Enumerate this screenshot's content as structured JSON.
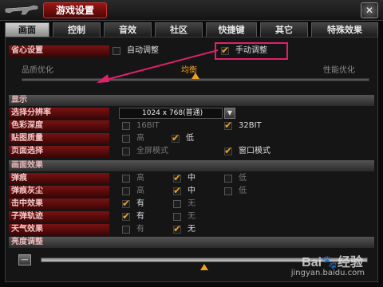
{
  "window": {
    "title": "游戏设置",
    "close_label": "✕"
  },
  "tabs": [
    "画面",
    "控制",
    "音效",
    "社区",
    "快捷键",
    "其它",
    "特殊效果"
  ],
  "quality": {
    "label": "省心设置",
    "auto_label": "自动调整",
    "manual_label": "手动调整",
    "auto_checked": false,
    "manual_checked": true,
    "left_label": "品质优化",
    "mid_label": "均衡",
    "right_label": "性能优化",
    "slider_value": 0.5
  },
  "display": {
    "heading": "显示",
    "resolution_label": "选择分辨率",
    "resolution_value": "1024 x 768(普通)",
    "color_label": "色彩深度",
    "color_opts": [
      {
        "text": "16BIT",
        "checked": false
      },
      {
        "text": "32BIT",
        "checked": true
      }
    ],
    "texture_label": "贴图质量",
    "texture_opts": [
      {
        "text": "高",
        "checked": false
      },
      {
        "text": "低",
        "checked": true
      }
    ],
    "window_label": "页面选择",
    "window_opts": [
      {
        "text": "全屏模式",
        "checked": false
      },
      {
        "text": "窗口模式",
        "checked": true
      }
    ]
  },
  "effects": {
    "heading": "画面效果",
    "rows": [
      {
        "label": "弹痕",
        "opts": [
          {
            "text": "高",
            "checked": false
          },
          {
            "text": "中",
            "checked": true
          },
          {
            "text": "低",
            "checked": false
          }
        ]
      },
      {
        "label": "弹痕灰尘",
        "opts": [
          {
            "text": "高",
            "checked": false
          },
          {
            "text": "中",
            "checked": true
          },
          {
            "text": "低",
            "checked": false
          }
        ]
      },
      {
        "label": "击中效果",
        "opts": [
          {
            "text": "有",
            "checked": true
          },
          {
            "text": "无",
            "checked": false
          }
        ]
      },
      {
        "label": "子弹轨迹",
        "opts": [
          {
            "text": "有",
            "checked": true
          },
          {
            "text": "无",
            "checked": false
          }
        ]
      },
      {
        "label": "天气效果",
        "opts": [
          {
            "text": "有",
            "checked": false
          },
          {
            "text": "无",
            "checked": true
          }
        ]
      }
    ]
  },
  "brightness": {
    "heading": "亮度调整",
    "minus_label": "—",
    "value": 0.5
  },
  "annotation": {
    "color": "#e0206a"
  },
  "watermark": {
    "site": "Bai",
    "brand": "经验",
    "url": "jingyan.baidu.com"
  }
}
